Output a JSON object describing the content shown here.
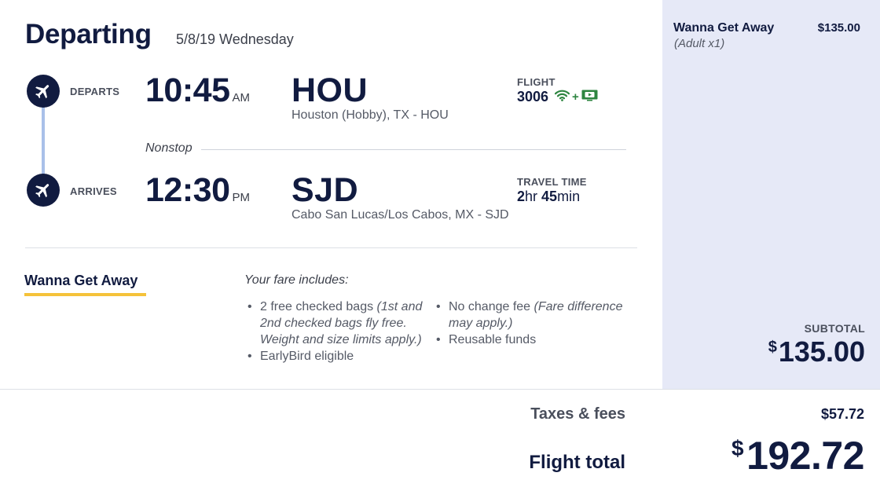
{
  "header": {
    "title": "Departing",
    "date": "5/8/19 Wednesday"
  },
  "departure": {
    "label": "DEPARTS",
    "time": "10:45",
    "ampm": "AM",
    "code": "HOU",
    "city": "Houston (Hobby), TX - HOU"
  },
  "arrival": {
    "label": "ARRIVES",
    "time": "12:30",
    "ampm": "PM",
    "code": "SJD",
    "city": "Cabo San Lucas/Los Cabos, MX - SJD"
  },
  "flight": {
    "label": "FLIGHT",
    "number": "3006",
    "amenities": [
      "wifi-icon",
      "live-tv-icon"
    ],
    "plus": "+"
  },
  "travel_time": {
    "label": "TRAVEL TIME",
    "hours": "2",
    "hr_unit": "hr",
    "minutes": "45",
    "min_unit": "min"
  },
  "stops": "Nonstop",
  "fare": {
    "name": "Wanna Get Away",
    "includes_label": "Your fare includes:",
    "left_items": [
      {
        "text": "2 free checked bags ",
        "note": "(1st and 2nd checked bags fly free. Weight and size limits apply.)"
      },
      {
        "text": "EarlyBird eligible",
        "note": ""
      }
    ],
    "right_items": [
      {
        "text": "No change fee ",
        "note": "(Fare difference may apply.)"
      },
      {
        "text": "Reusable funds",
        "note": ""
      }
    ]
  },
  "sidebar": {
    "fare_name": "Wanna Get Away",
    "fare_price": "$135.00",
    "passenger": "(Adult x1)",
    "subtotal_label": "SUBTOTAL",
    "subtotal_currency": "$",
    "subtotal_value": "135.00"
  },
  "totals": {
    "taxes_label": "Taxes & fees",
    "taxes_value": "$57.72",
    "total_label": "Flight total",
    "total_currency": "$",
    "total_value": "192.72"
  },
  "colors": {
    "navy": "#111b40",
    "accent_yellow": "#f5c23a",
    "timeline_blue": "#a9c0e9",
    "sidebar_bg": "#e6e9f7",
    "amenity_green": "#2e8540"
  }
}
